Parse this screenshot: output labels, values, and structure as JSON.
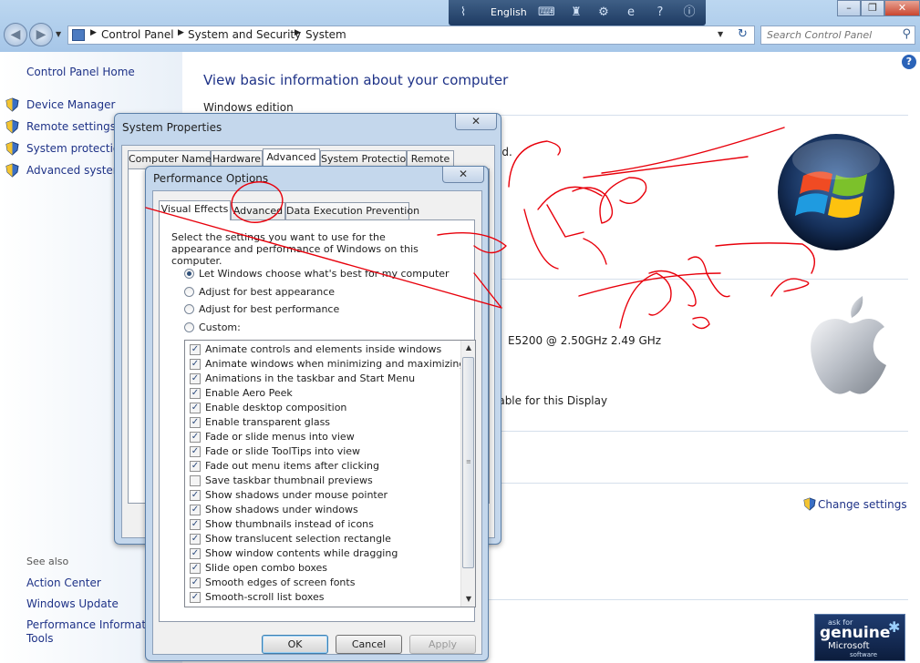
{
  "langbar": {
    "language": "English"
  },
  "address": {
    "crumbs": [
      "Control Panel",
      "System and Security",
      "System"
    ]
  },
  "search": {
    "placeholder": "Search Control Panel"
  },
  "left": {
    "home": "Control Panel Home",
    "links": [
      "Device Manager",
      "Remote settings",
      "System protection",
      "Advanced system"
    ],
    "see_also": "See also",
    "see_links": [
      "Action Center",
      "Windows Update",
      "Performance Information and",
      "Tools"
    ]
  },
  "main": {
    "heading": "View basic information about your computer",
    "section": "Windows edition",
    "processor": "E5200  @ 2.50GHz   2.49 GHz",
    "pen": "lable for this Display",
    "reserved": "ed.",
    "change_settings": "Change settings",
    "genuine": {
      "ask": "ask for",
      "word": "genuine",
      "brand": "Microsoft",
      "sub": "software"
    }
  },
  "sysprops": {
    "title": "System Properties",
    "tabs": [
      "Computer Name",
      "Hardware",
      "Advanced",
      "System Protection",
      "Remote"
    ]
  },
  "perf": {
    "title": "Performance Options",
    "tabs": [
      "Visual Effects",
      "Advanced",
      "Data Execution Prevention"
    ],
    "description": "Select the settings you want to use for the appearance and performance of Windows on this computer.",
    "options": [
      "Let Windows choose what's best for my computer",
      "Adjust for best appearance",
      "Adjust for best performance",
      "Custom:"
    ],
    "items": [
      {
        "label": "Animate controls and elements inside windows",
        "checked": true
      },
      {
        "label": "Animate windows when minimizing and maximizing",
        "checked": true
      },
      {
        "label": "Animations in the taskbar and Start Menu",
        "checked": true
      },
      {
        "label": "Enable Aero Peek",
        "checked": true
      },
      {
        "label": "Enable desktop composition",
        "checked": true
      },
      {
        "label": "Enable transparent glass",
        "checked": true
      },
      {
        "label": "Fade or slide menus into view",
        "checked": true
      },
      {
        "label": "Fade or slide ToolTips into view",
        "checked": true
      },
      {
        "label": "Fade out menu items after clicking",
        "checked": true
      },
      {
        "label": "Save taskbar thumbnail previews",
        "checked": false
      },
      {
        "label": "Show shadows under mouse pointer",
        "checked": true
      },
      {
        "label": "Show shadows under windows",
        "checked": true
      },
      {
        "label": "Show thumbnails instead of icons",
        "checked": true
      },
      {
        "label": "Show translucent selection rectangle",
        "checked": true
      },
      {
        "label": "Show window contents while dragging",
        "checked": true
      },
      {
        "label": "Slide open combo boxes",
        "checked": true
      },
      {
        "label": "Smooth edges of screen fonts",
        "checked": true
      },
      {
        "label": "Smooth-scroll list boxes",
        "checked": true
      }
    ],
    "buttons": {
      "ok": "OK",
      "cancel": "Cancel",
      "apply": "Apply"
    }
  },
  "colors": {
    "link": "#1e3287",
    "annotation": "#e8000b",
    "title_bar": "#a6c6e8"
  }
}
